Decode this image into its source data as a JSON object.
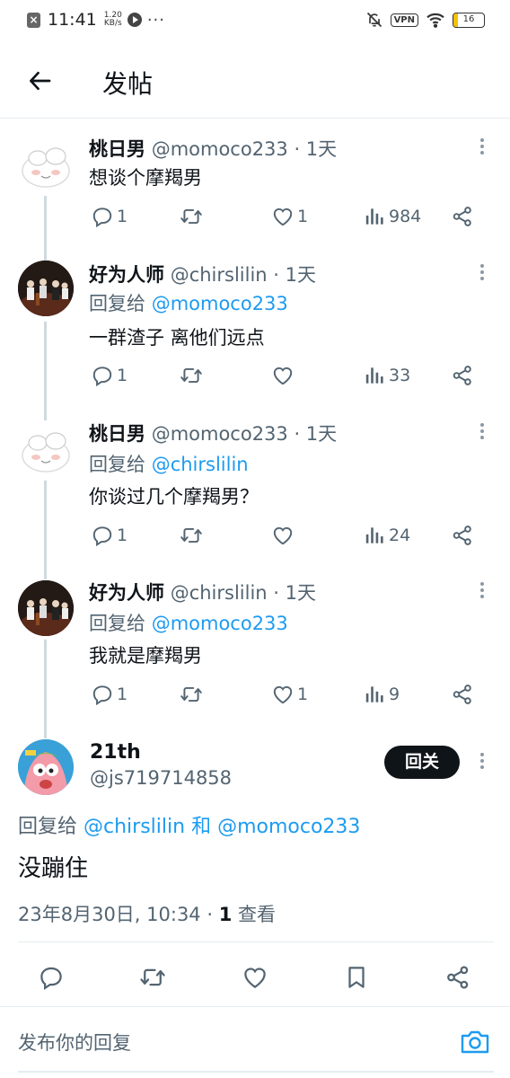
{
  "status_bar": {
    "time": "11:41",
    "speed_value": "1.20",
    "speed_unit": "KB/s",
    "dots": "···",
    "vpn": "VPN",
    "battery": "16",
    "battery_level": 0.16
  },
  "header": {
    "title": "发帖"
  },
  "thread": [
    {
      "name": "桃日男",
      "handle": "@momoco233 · 1天",
      "reply_label": "",
      "reply_to": "",
      "text": "想谈个摩羯男",
      "replies": "1",
      "retweets": "",
      "likes": "1",
      "views": "984"
    },
    {
      "name": "好为人师",
      "handle": "@chirslilin · 1天",
      "reply_label": "回复给",
      "reply_to": "@momoco233",
      "text": "一群渣子 离他们远点",
      "replies": "1",
      "retweets": "",
      "likes": "",
      "views": "33"
    },
    {
      "name": "桃日男",
      "handle": "@momoco233 · 1天",
      "reply_label": "回复给",
      "reply_to": "@chirslilin",
      "text": "你谈过几个摩羯男？",
      "replies": "1",
      "retweets": "",
      "likes": "",
      "views": "24"
    },
    {
      "name": "好为人师",
      "handle": "@chirslilin · 1天",
      "reply_label": "回复给",
      "reply_to": "@momoco233",
      "text": "我就是摩羯男",
      "replies": "1",
      "retweets": "",
      "likes": "1",
      "views": "9"
    }
  ],
  "main_tweet": {
    "name": "21th",
    "handle": "@js719714858",
    "follow_label": "回关",
    "reply_label": "回复给",
    "reply_to_1": "@chirslilin",
    "conjunction": "和",
    "reply_to_2": "@momoco233",
    "text": "没蹦住",
    "date": "23年8月30日, 10:34 · ",
    "views_count": "1",
    "views_label": " 查看"
  },
  "reply_bar": {
    "placeholder": "发布你的回复"
  },
  "colors": {
    "accent": "#1d9bf0",
    "text": "#0f1419",
    "secondary": "#536471",
    "follow_button": "#0f1419"
  },
  "icons": [
    "back-arrow-icon",
    "reply-icon",
    "retweet-icon",
    "heart-icon",
    "views-icon",
    "share-icon",
    "bookmark-icon",
    "camera-icon",
    "more-icon"
  ]
}
